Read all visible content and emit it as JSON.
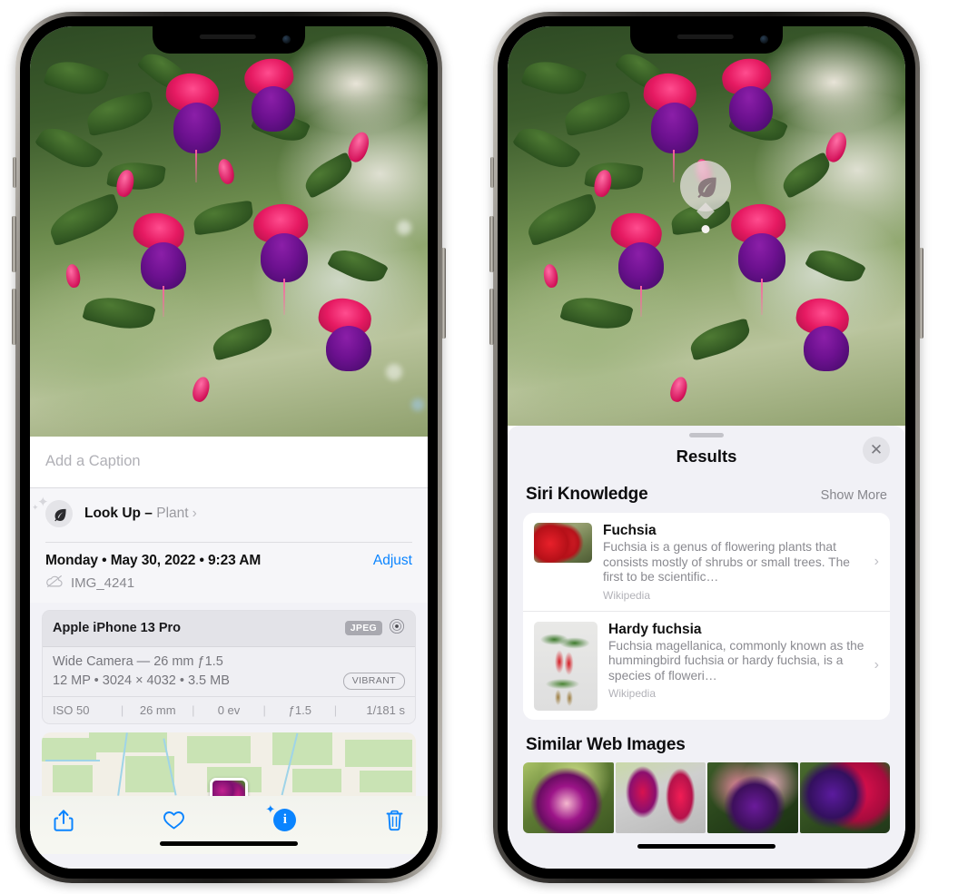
{
  "left_phone": {
    "caption": {
      "placeholder": "Add a Caption",
      "value": ""
    },
    "lookup": {
      "label": "Look Up",
      "dash": " – ",
      "kind": "Plant",
      "chevron": "›",
      "icon": "leaf-icon"
    },
    "meta": {
      "date": "Monday • May 30, 2022 • 9:23 AM",
      "adjust": "Adjust",
      "filename": "IMG_4241",
      "cloud_icon": "icloud-slash-icon"
    },
    "exif": {
      "device": "Apple iPhone 13 Pro",
      "format_tag": "JPEG",
      "aperture_icon": "aperture-icon",
      "lens_line": "Wide Camera — 26 mm ƒ1.5",
      "spec_line": "12 MP • 3024 × 4032 • 3.5 MB",
      "style_tag": "VIBRANT",
      "footer": [
        "ISO 50",
        "26 mm",
        "0 ev",
        "ƒ1.5",
        "1/181 s"
      ]
    },
    "toolbar": {
      "share_label": "share-icon",
      "favorite_label": "heart-icon",
      "info_label": "info-sparkle-icon",
      "delete_label": "trash-icon"
    }
  },
  "right_phone": {
    "badge": {
      "icon": "leaf-icon"
    },
    "sheet": {
      "title": "Results",
      "close_label": "✕"
    },
    "siri_knowledge": {
      "title": "Siri Knowledge",
      "action": "Show More",
      "cards": [
        {
          "title": "Fuchsia",
          "description": "Fuchsia is a genus of flowering plants that consists mostly of shrubs or small trees. The first to be scientific…",
          "source": "Wikipedia",
          "chevron": "›"
        },
        {
          "title": "Hardy fuchsia",
          "description": "Fuchsia magellanica, commonly known as the hummingbird fuchsia or hardy fuchsia, is a species of floweri…",
          "source": "Wikipedia",
          "chevron": "›"
        }
      ]
    },
    "similar_web_images": {
      "title": "Similar Web Images",
      "thumbs": [
        "web-image-1",
        "web-image-2",
        "web-image-3",
        "web-image-4"
      ]
    }
  },
  "colors": {
    "accent_blue": "#0a84ff",
    "sheet_bg": "#f1f1f6",
    "card_bg": "#ffffff",
    "secondary_text": "#8a8a90"
  }
}
